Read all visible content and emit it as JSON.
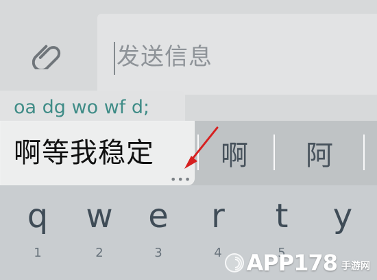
{
  "compose": {
    "placeholder": "发送信息",
    "attachment_icon": "paperclip-icon"
  },
  "ime": {
    "composing_text": "oa dg wo wf d;",
    "candidates": [
      {
        "label": "啊等我稳定"
      },
      {
        "label": "啊"
      },
      {
        "label": "阿"
      }
    ],
    "more_indicator": "•••"
  },
  "keyboard": {
    "keys": [
      {
        "letter": "q",
        "number": "1"
      },
      {
        "letter": "w",
        "number": "2"
      },
      {
        "letter": "e",
        "number": "3"
      },
      {
        "letter": "r",
        "number": "4"
      },
      {
        "letter": "t",
        "number": "5"
      },
      {
        "letter": "y",
        "number": ""
      }
    ]
  },
  "watermark": {
    "text": "APP178",
    "subtext": "手游网"
  },
  "colors": {
    "accent_text": "#3f8c87",
    "annotation_arrow": "#d62020"
  }
}
